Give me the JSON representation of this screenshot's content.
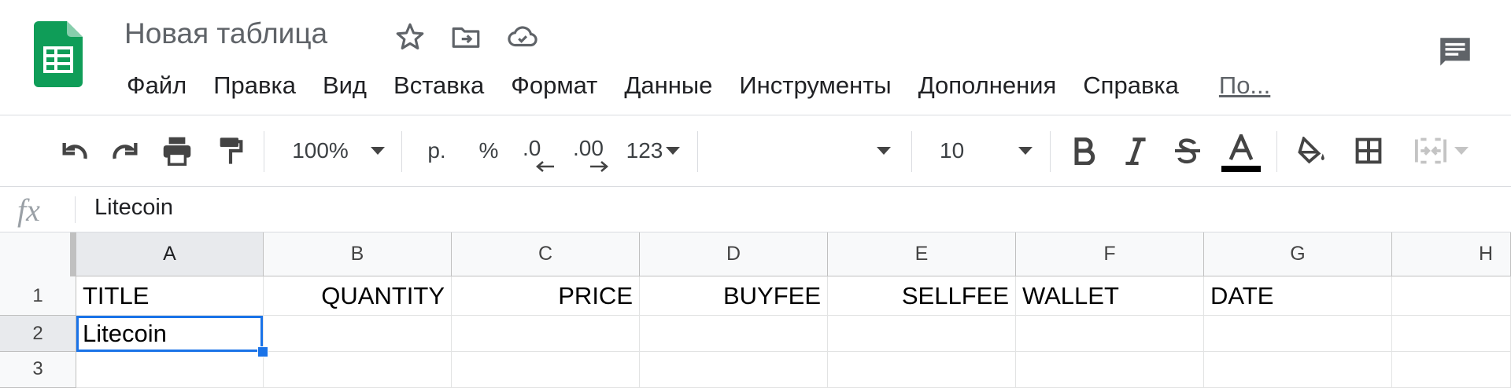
{
  "doc": {
    "title": "Новая таблица"
  },
  "menu": [
    "Файл",
    "Правка",
    "Вид",
    "Вставка",
    "Формат",
    "Данные",
    "Инструменты",
    "Дополнения",
    "Справка"
  ],
  "menu_more": "По...",
  "toolbar": {
    "zoom": "100%",
    "currency": "р.",
    "percent": "%",
    "dec_decrease": ".0",
    "dec_increase": ".00",
    "more_formats": "123",
    "font": "",
    "font_size": "10",
    "text_color": "#000000"
  },
  "formula_bar": {
    "fx": "fx",
    "value": "Litecoin"
  },
  "grid": {
    "columns": [
      "A",
      "B",
      "C",
      "D",
      "E",
      "F",
      "G",
      "H"
    ],
    "rows": [
      "1",
      "2",
      "3"
    ],
    "cells": [
      [
        "TITLE",
        "QUANTITY",
        "PRICE",
        "BUYFEE",
        "SELLFEE",
        "WALLET",
        "DATE",
        ""
      ],
      [
        "Litecoin",
        "",
        "",
        "",
        "",
        "",
        "",
        ""
      ],
      [
        "",
        "",
        "",
        "",
        "",
        "",
        "",
        ""
      ]
    ],
    "selected_cell": "A2"
  },
  "colors": {
    "accent": "#1a73e8",
    "sheets_green": "#0f9d58"
  }
}
